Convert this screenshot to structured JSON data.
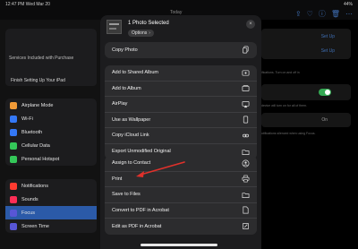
{
  "status": {
    "time": "12:47 PM",
    "date": "Wed Mar 20",
    "right": "44%"
  },
  "nav": {
    "today": "Today"
  },
  "sidebar": {
    "services": "Services Included with Purchase",
    "finish": "Finish Setting Up Your iPad",
    "group1": [
      {
        "label": "Airplane Mode",
        "color": "#f09a37"
      },
      {
        "label": "Wi-Fi",
        "color": "#3478f6"
      },
      {
        "label": "Bluetooth",
        "color": "#3478f6"
      },
      {
        "label": "Cellular Data",
        "color": "#34c759"
      },
      {
        "label": "Personal Hotspot",
        "color": "#34c759"
      }
    ],
    "group2": [
      {
        "label": "Notifications",
        "color": "#ff3b30"
      },
      {
        "label": "Sounds",
        "color": "#ff2d55"
      },
      {
        "label": "Focus",
        "color": "#5856d6"
      },
      {
        "label": "Screen Time",
        "color": "#5856d6"
      }
    ]
  },
  "right": {
    "setup1": "Set Up",
    "setup2": "Set Up",
    "note1": "ifications. Turn on and off in",
    "note2": "device will turn on for all of them.",
    "on": "On",
    "note3": "otifications silenced when using Focus."
  },
  "sheet": {
    "title": "1 Photo Selected",
    "options": "Options",
    "close": "×",
    "group1": [
      {
        "label": "Copy Photo",
        "icon": "copy-icon"
      }
    ],
    "group2": [
      {
        "label": "Add to Shared Album",
        "icon": "shared-album-icon"
      },
      {
        "label": "Add to Album",
        "icon": "album-icon"
      },
      {
        "label": "AirPlay",
        "icon": "airplay-icon"
      },
      {
        "label": "Use as Wallpaper",
        "icon": "wallpaper-icon"
      },
      {
        "label": "Copy iCloud Link",
        "icon": "link-icon"
      },
      {
        "label": "Export Unmodified Original",
        "icon": "folder-icon"
      }
    ],
    "group3": [
      {
        "label": "Assign to Contact",
        "icon": "contact-icon"
      },
      {
        "label": "Print",
        "icon": "printer-icon"
      },
      {
        "label": "Save to Files",
        "icon": "folder-icon"
      },
      {
        "label": "Convert to PDF in Acrobat",
        "icon": "acrobat-icon"
      },
      {
        "label": "Edit as PDF in Acrobat",
        "icon": "edit-icon"
      }
    ]
  },
  "annotation": {
    "arrow_color": "#e0312b"
  }
}
